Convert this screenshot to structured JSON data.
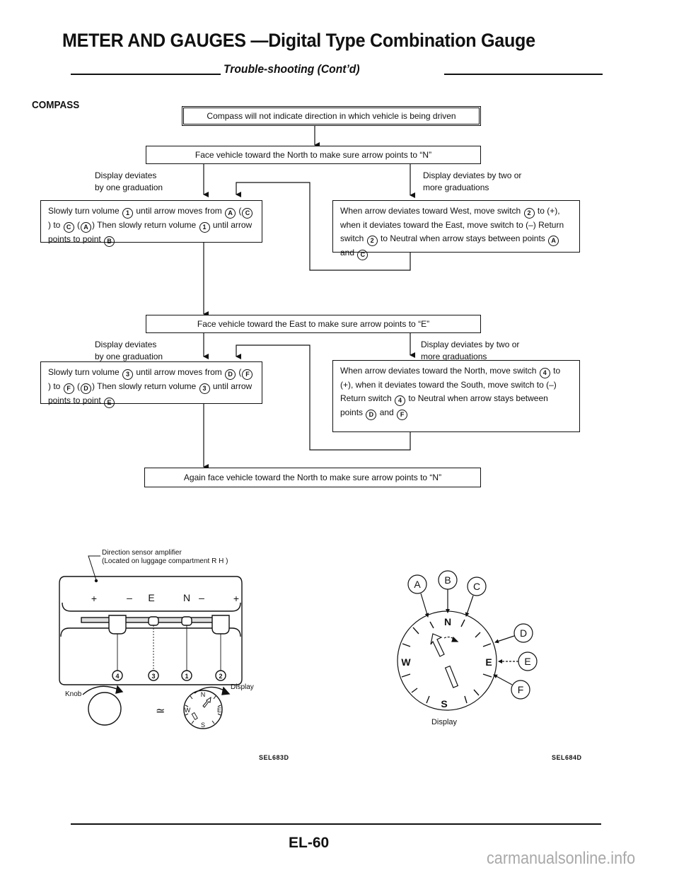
{
  "header": {
    "title": "METER AND GAUGES —Digital Type Combination Gauge",
    "subtitle": "Trouble-shooting (Cont’d)"
  },
  "section": {
    "label": "COMPASS"
  },
  "flowchart": {
    "symptom": "Compass will not indicate direction in which vehicle is being driven",
    "step_north": "Face vehicle toward the North to make sure arrow points to “N”",
    "north_branch_one": [
      "Display deviates",
      "by one graduation"
    ],
    "north_branch_two": [
      "Display deviates by two or",
      "more graduations"
    ],
    "north_fix_one": {
      "parts": [
        "Slowly turn volume ",
        "1",
        " until arrow moves from ",
        "A",
        " (",
        "C",
        ") to ",
        "C",
        " (",
        "A",
        ")  Then slowly return volume ",
        "1",
        " until arrow points to point ",
        "B"
      ]
    },
    "north_fix_two": {
      "parts": [
        "When arrow deviates toward West, move switch ",
        "2",
        " to (+), when it deviates toward the East, move switch to (–)  Return switch ",
        "2",
        " to Neutral when arrow stays between points ",
        "A",
        " and ",
        "C"
      ]
    },
    "step_east": "Face vehicle toward the East to make sure arrow points to “E”",
    "east_branch_one": [
      "Display deviates",
      "by one graduation"
    ],
    "east_branch_two": [
      "Display deviates by two or",
      "more graduations"
    ],
    "east_fix_one": {
      "parts": [
        "Slowly turn volume ",
        "3",
        " until arrow moves from ",
        "D",
        " (",
        "F",
        ") to ",
        "F",
        " (",
        "D",
        ")  Then slowly return volume ",
        "3",
        " until arrow points to point ",
        "E"
      ]
    },
    "east_fix_two": {
      "parts": [
        "When arrow deviates toward the North, move switch ",
        "4",
        " to (+), when it deviates toward the South, move switch to (–)  Return switch ",
        "4",
        " to Neutral when arrow stays between points ",
        "D",
        " and ",
        "F"
      ]
    },
    "final_step": "Again face vehicle toward the North to make sure arrow points to “N”"
  },
  "amplifier_figure": {
    "label_line1": "Direction sensor amplifier",
    "label_line2": "(Located on luggage compartment R H )",
    "panel_marks": [
      "+",
      "–",
      "E",
      "N",
      "–",
      "+"
    ],
    "switch_numbers": [
      "4",
      "3",
      "1",
      "2"
    ],
    "knob_label": "Knob",
    "display_label": "Display",
    "approx_symbol": "≃",
    "compass_letters": {
      "n": "N",
      "e": "E",
      "s": "S",
      "w": "W"
    },
    "figure_code": "SEL683D"
  },
  "display_figure": {
    "points": [
      "A",
      "B",
      "C",
      "D",
      "E",
      "F"
    ],
    "compass_letters": {
      "n": "N",
      "e": "E",
      "s": "S",
      "w": "W"
    },
    "caption": "Display",
    "figure_code": "SEL684D"
  },
  "footer": {
    "page_number": "EL-60",
    "watermark": "carmanualsonline.info"
  }
}
